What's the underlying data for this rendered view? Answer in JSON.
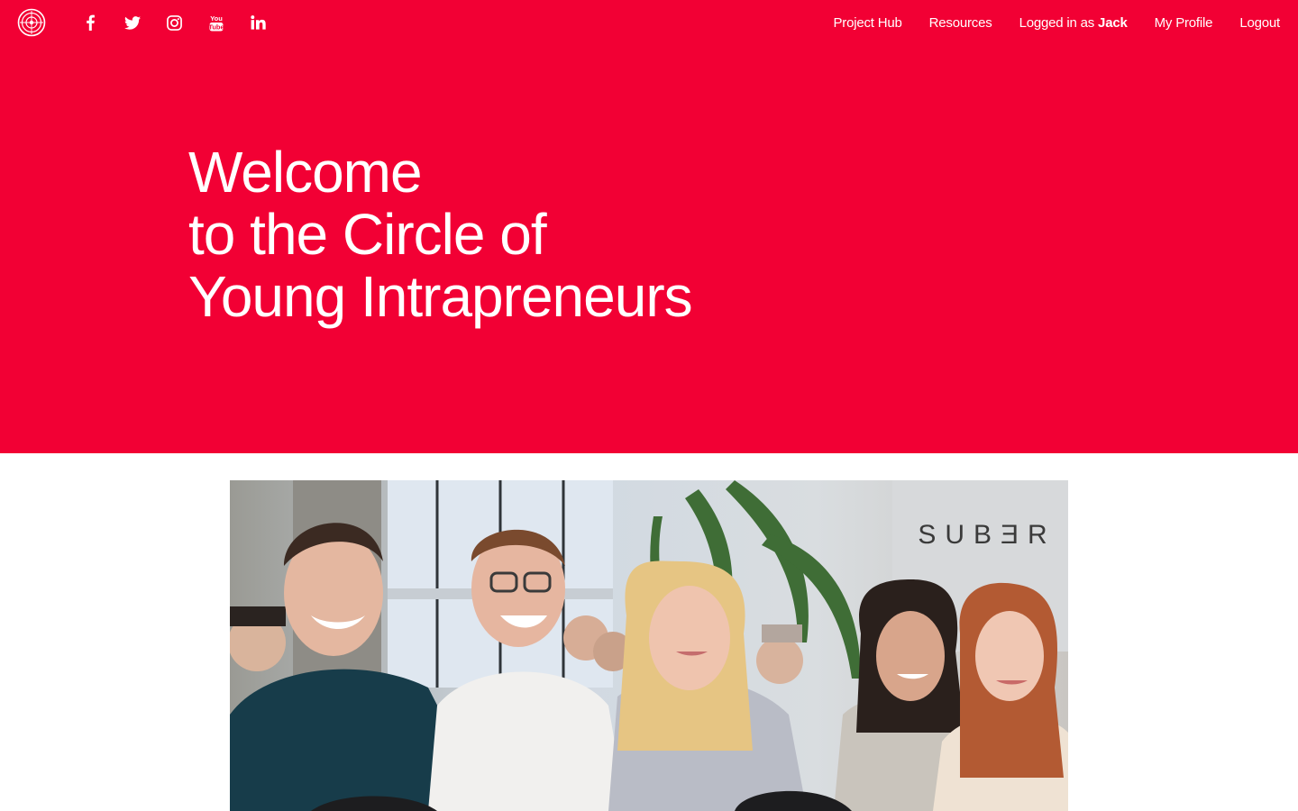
{
  "brand": {
    "logo_icon": "circle-emblem-icon",
    "accent_color": "#f20034",
    "text_color": "#ffffff"
  },
  "social": [
    {
      "name": "facebook-icon",
      "glyph": "f"
    },
    {
      "name": "twitter-icon",
      "glyph": "bird"
    },
    {
      "name": "instagram-icon",
      "glyph": "camera"
    },
    {
      "name": "youtube-icon",
      "glyph": "You Tube"
    },
    {
      "name": "linkedin-icon",
      "glyph": "in"
    }
  ],
  "nav": {
    "project_hub": "Project Hub",
    "resources": "Resources",
    "logged_in_prefix": "Logged in as",
    "user_name": "Jack",
    "my_profile": "My Profile",
    "logout": "Logout"
  },
  "hero": {
    "line1": "Welcome",
    "line2": "to the Circle of",
    "line3": "Young Intrapreneurs"
  },
  "photo": {
    "sign_text": "SUBƎR"
  }
}
